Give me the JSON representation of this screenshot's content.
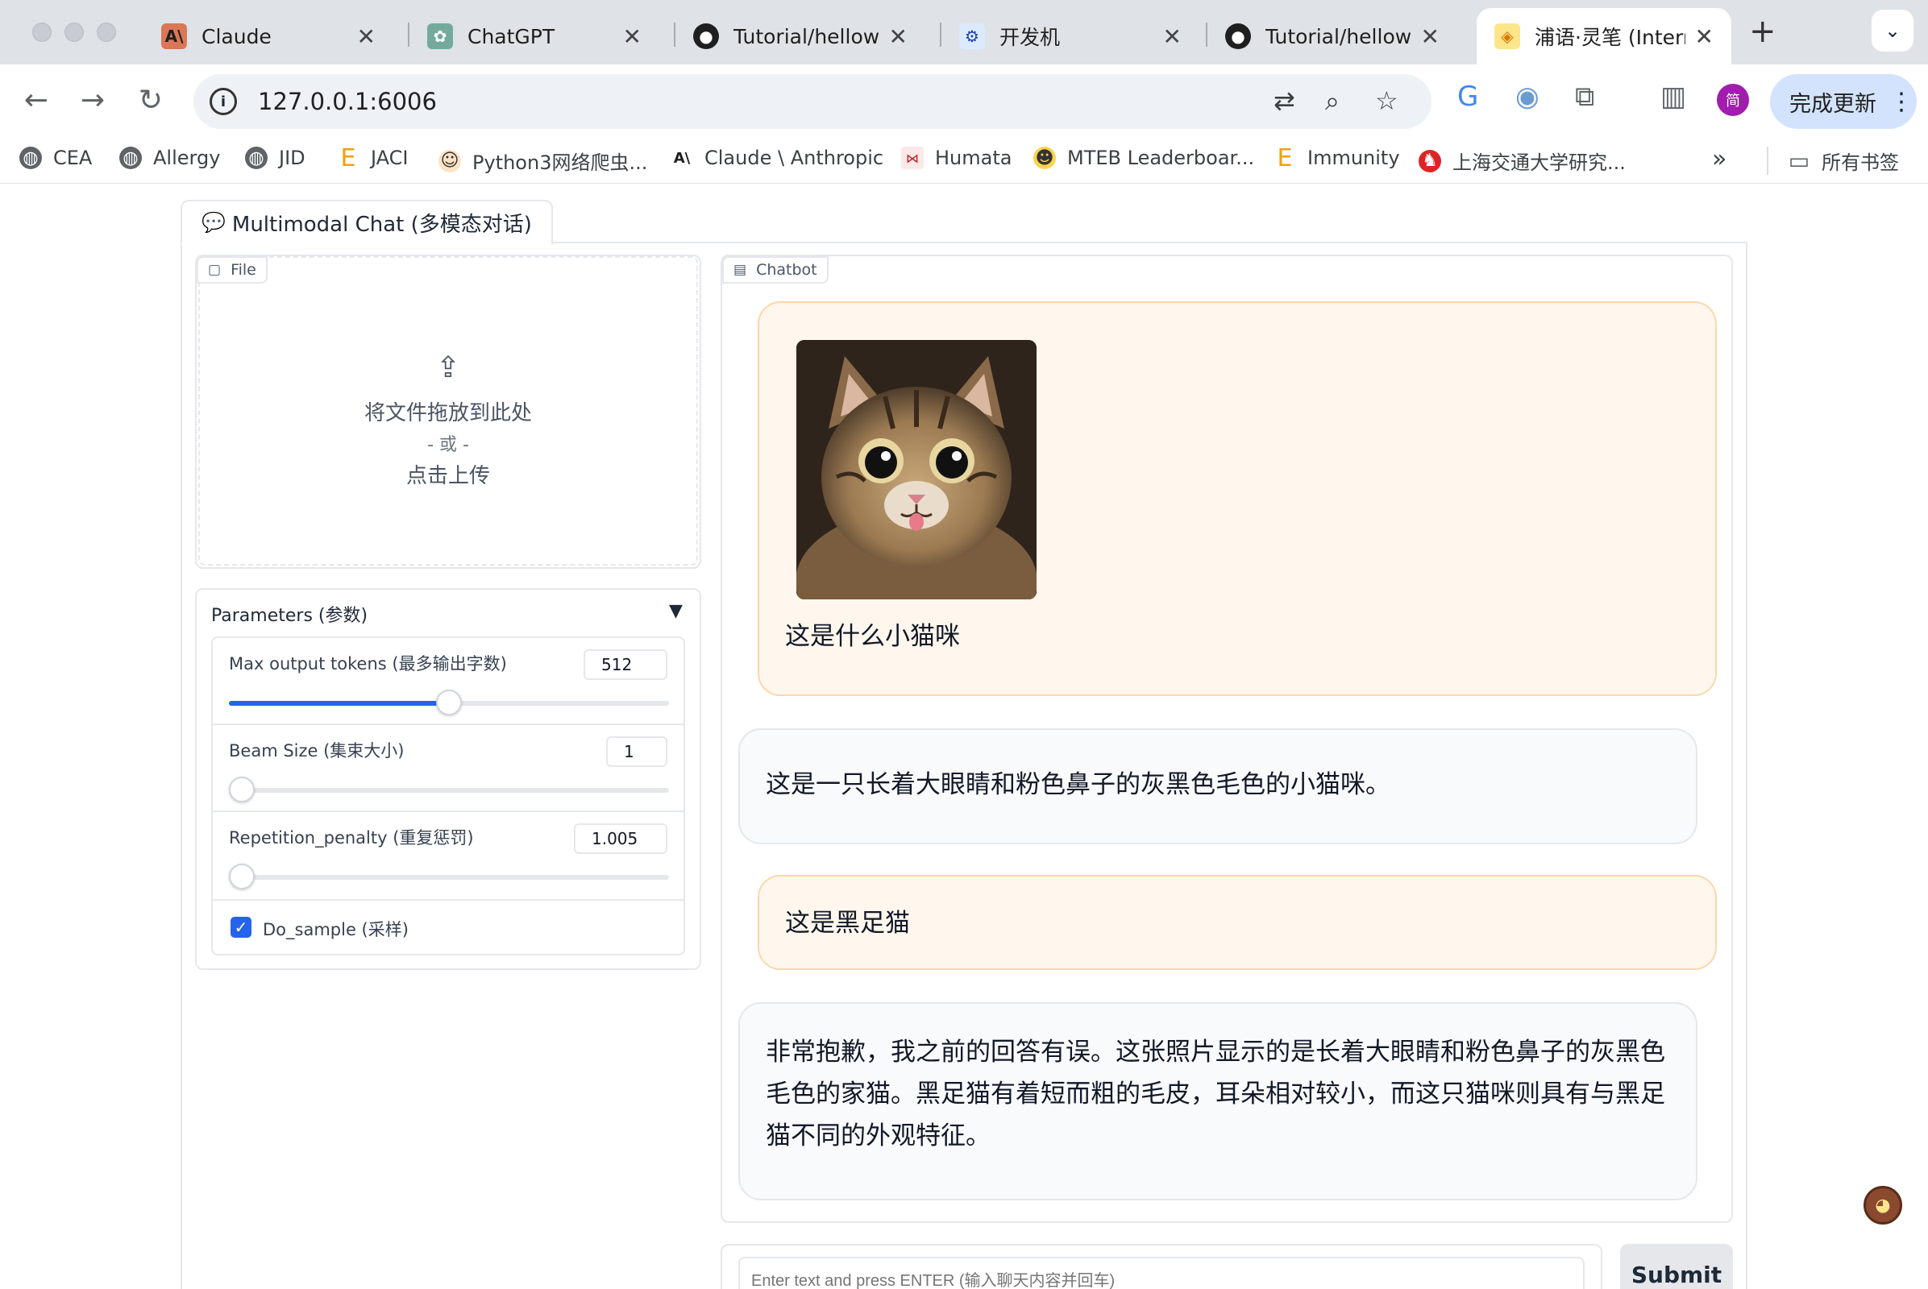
{
  "browser": {
    "tabs": [
      {
        "title": "Claude",
        "icon": "anthropic-icon"
      },
      {
        "title": "ChatGPT",
        "icon": "openai-icon"
      },
      {
        "title": "Tutorial/hellowor",
        "icon": "github-icon"
      },
      {
        "title": "开发机",
        "icon": "devbox-icon"
      },
      {
        "title": "Tutorial/hellowor",
        "icon": "github-icon"
      },
      {
        "title": "浦语·灵笔 (Interr",
        "icon": "internlm-icon",
        "active": true
      }
    ],
    "url": "127.0.0.1:6006",
    "update_label": "完成更新",
    "profile_initial": "简",
    "bookmarks": [
      {
        "label": "CEA"
      },
      {
        "label": "Allergy"
      },
      {
        "label": "JID"
      },
      {
        "label": "JACI"
      },
      {
        "label": "Python3网络爬虫..."
      },
      {
        "label": "Claude \\ Anthropic"
      },
      {
        "label": "Humata"
      },
      {
        "label": "MTEB Leaderboar..."
      },
      {
        "label": "Immunity"
      },
      {
        "label": "上海交通大学研究..."
      }
    ],
    "all_bookmarks_label": "所有书签"
  },
  "app": {
    "tab_label": "Multimodal Chat (多模态对话)",
    "file_label": "File",
    "upload": {
      "line1": "将文件拖放到此处",
      "line2": "- 或 -",
      "line3": "点击上传"
    },
    "parameters": {
      "title": "Parameters (参数)",
      "max_tokens": {
        "label": "Max output tokens (最多输出字数)",
        "value": "512",
        "fraction": 0.5
      },
      "beam_size": {
        "label": "Beam Size (集束大小)",
        "value": "1",
        "fraction": 0.0
      },
      "repetition_penalty": {
        "label": "Repetition_penalty (重复惩罚)",
        "value": "1.005",
        "fraction": 0.0
      },
      "do_sample": {
        "label": "Do_sample (采样)",
        "checked": true
      }
    },
    "chatbot_label": "Chatbot",
    "messages": [
      {
        "role": "user",
        "text": "这是什么小猫咪"
      },
      {
        "role": "bot",
        "text": "这是一只长着大眼睛和粉色鼻子的灰黑色毛色的小猫咪。"
      },
      {
        "role": "user",
        "text": "这是黑足猫"
      },
      {
        "role": "bot",
        "text": "非常抱歉，我之前的回答有误。这张照片显示的是长着大眼睛和粉色鼻子的灰黑色毛色的家猫。黑足猫有着短而粗的毛皮，耳朵相对较小，而这只猫咪则具有与黑足猫不同的外观特征。"
      }
    ],
    "input_placeholder": "Enter text and press ENTER (输入聊天内容并回车)",
    "submit_label": "Submit"
  },
  "colors": {
    "accent": "#2563eb",
    "user_bubble": "#fff7ed",
    "bot_bubble": "#f9fafb"
  }
}
